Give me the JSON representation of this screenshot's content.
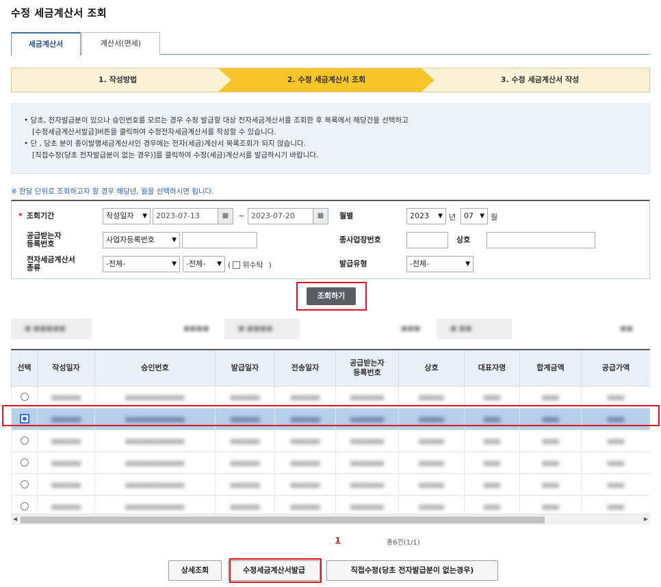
{
  "page_title": "수정 세금계산서 조회",
  "tabs": [
    {
      "label": "세금계산서",
      "active": true
    },
    {
      "label": "계산서(면세)",
      "active": false
    }
  ],
  "steps": [
    {
      "label": "1. 작성방법"
    },
    {
      "label": "2. 수정 세금계산서 조회",
      "active": true
    },
    {
      "label": "3. 수정 세금계산서 작성"
    }
  ],
  "info": {
    "line1": "• 당초, 전자발급분이 있으나 승인번호를 모르는 경우 수정 발급할 대상 전자세금계산서를 조회한 후 목록에서 해당건을 선택하고",
    "line2": "[수정세금계산서발급]버튼을 클릭하여 수정전자세금계산서를 작성할 수 있습니다.",
    "line3": "• 단 , 당초 분이 종이발행세금계산서인 경우에는 전자(세금)계산서 목록조회가 되지 않습니다.",
    "line4": "[직접수정(당초 전자발급분이 없는 경우)]를 클릭하여 수정(세금)계산서를 발급하시기 바랍니다."
  },
  "note": "※ 한달 단위로 조회하고자 할 경우 해당년, 월을 선택하시면 됩니다.",
  "form": {
    "period_label": "조회기간",
    "required_mark": "*",
    "date_type": "작성일자",
    "date_from": "2023-07-13",
    "date_sep": "~",
    "date_to": "2023-07-20",
    "month_label": "월별",
    "year": "2023",
    "year_unit": "년",
    "month": "07",
    "month_unit": "월",
    "receiver_label_1": "공급받는자",
    "receiver_label_2": "등록번호",
    "receiver_type": "사업자등록번호",
    "receiver_value": "",
    "branch_label": "종사업장번호",
    "branch_value": "",
    "company_label": "상호",
    "company_value": "",
    "kind_label_1": "전자세금계산서",
    "kind_label_2": "종류",
    "kind_1": "-전체-",
    "kind_2": "-전체-",
    "consign_open": "(",
    "consign_label": "위수탁",
    "consign_close": ")",
    "issue_type_label": "발급유형",
    "issue_type": "-전체-"
  },
  "search_button": "조회하기",
  "table": {
    "headers": [
      "선택",
      "작성일자",
      "승인번호",
      "발급일자",
      "전송일자",
      "공급받는자\n등록번호",
      "상호",
      "대표자명",
      "합계금액",
      "공급가액"
    ],
    "selected_row": 1,
    "row_count": 6
  },
  "pagination": {
    "current_page": "1",
    "summary": "총6건(1/1)"
  },
  "buttons": {
    "detail": "상세조회",
    "issue": "수정세금계산서발급",
    "direct": "직접수정(당초 전자발급분이 없는경우)"
  },
  "colors": {
    "highlight": "#e0101a",
    "step_active": "#f6c52a",
    "selected_row": "#b8cfe9"
  },
  "icons": [
    "calendar-icon",
    "chevron-down-icon",
    "radio-icon",
    "scroll-left-icon",
    "scroll-right-icon"
  ]
}
